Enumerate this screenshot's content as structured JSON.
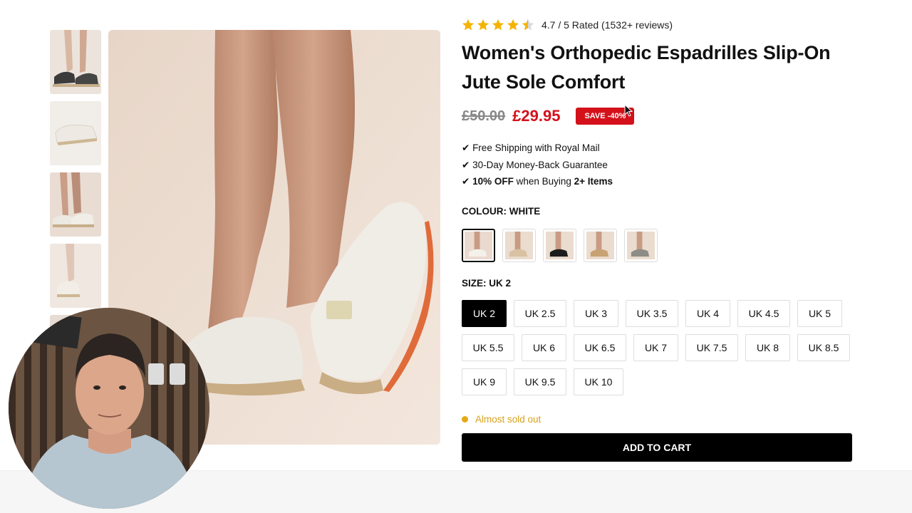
{
  "product": {
    "rating_text": "4.7 / 5 Rated (1532+ reviews)",
    "rating_value": 4.7,
    "title": "Women's Orthopedic Espadrilles Slip-On Jute Sole Comfort",
    "old_price": "£50.00",
    "new_price": "£29.95",
    "save_badge": "SAVE -40%",
    "perks": [
      {
        "check": "✔",
        "pre": " Free Shipping with Royal Mail",
        "bold1": "",
        "mid": "",
        "bold2": ""
      },
      {
        "check": "✔",
        "pre": " 30-Day Money-Back Guarantee",
        "bold1": "",
        "mid": "",
        "bold2": ""
      },
      {
        "check": "✔",
        "pre": " ",
        "bold1": "10% OFF",
        "mid": " when Buying ",
        "bold2": "2+ Items"
      }
    ],
    "colour_label": "COLOUR: WHITE",
    "size_label": "SIZE: UK 2",
    "size_rows": [
      [
        "UK 2",
        "UK 2.5",
        "UK 3",
        "UK 3.5",
        "UK 4",
        "UK 4.5",
        "UK 5"
      ],
      [
        "UK 5.5",
        "UK 6",
        "UK 6.5",
        "UK 7",
        "UK 7.5",
        "UK 8",
        "UK 8.5"
      ],
      [
        "UK 9",
        "UK 9.5",
        "UK 10"
      ]
    ],
    "stock_text": "Almost sold out",
    "add_to_cart": "ADD TO CART"
  },
  "colors": {
    "price_red": "#d4111b",
    "stock_amber": "#e6a817",
    "star_gold": "#f5b301",
    "primary_button": "#000000"
  }
}
